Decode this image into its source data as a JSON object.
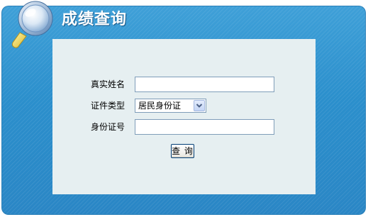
{
  "header": {
    "title": "成绩查询",
    "icon": "magnifier-icon"
  },
  "form": {
    "name_label": "真实姓名",
    "name_value": "",
    "id_type_label": "证件类型",
    "id_type_selected": "居民身份证",
    "id_number_label": "身份证号",
    "id_number_value": "",
    "submit_label": "查 询"
  },
  "colors": {
    "outer_panel": "#2b8fcc",
    "inner_panel": "#e6eff1",
    "title_text": "#ffffff"
  }
}
